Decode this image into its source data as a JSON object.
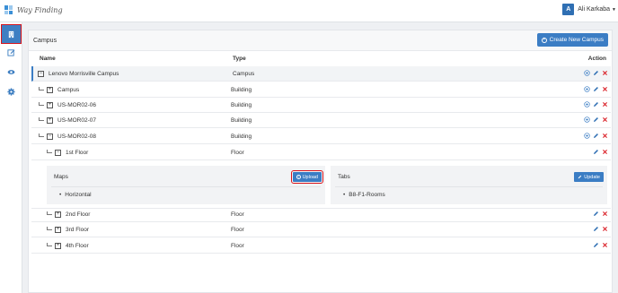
{
  "app": {
    "title": "Way Finding"
  },
  "user": {
    "initial": "A",
    "name": "Ali Karkaba"
  },
  "sidebar": {
    "items": [
      {
        "icon": "building-icon",
        "active": true
      },
      {
        "icon": "edit-icon",
        "active": false
      },
      {
        "icon": "eye-icon",
        "active": false
      },
      {
        "icon": "gear-icon",
        "active": false
      }
    ]
  },
  "panel": {
    "title": "Campus",
    "create_label": "Create New Campus"
  },
  "table": {
    "headers": {
      "name": "Name",
      "type": "Type",
      "action": "Action"
    },
    "rows": [
      {
        "name": "Lenovo Morrisville Campus",
        "type": "Campus"
      },
      {
        "name": "Campus",
        "type": "Building"
      },
      {
        "name": "US-MOR02-06",
        "type": "Building"
      },
      {
        "name": "US-MOR02-07",
        "type": "Building"
      },
      {
        "name": "US-MOR02-08",
        "type": "Building"
      },
      {
        "name": "1st Floor",
        "type": "Floor"
      },
      {
        "name": "2nd Floor",
        "type": "Floor"
      },
      {
        "name": "3rd Floor",
        "type": "Floor"
      },
      {
        "name": "4th Floor",
        "type": "Floor"
      }
    ]
  },
  "detail": {
    "maps": {
      "title": "Maps",
      "button": "Upload",
      "items": [
        "Horizontal"
      ]
    },
    "tabs": {
      "title": "Tabs",
      "button": "Update",
      "items": [
        "B8-F1-Rooms"
      ]
    }
  },
  "colors": {
    "accent": "#3b7dc4",
    "delete": "#d8141c",
    "highlight": "#d8141c"
  }
}
